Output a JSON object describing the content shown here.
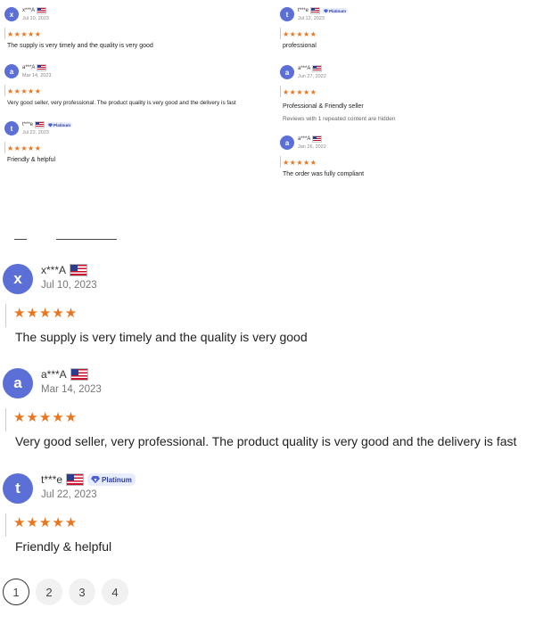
{
  "colors": {
    "avatar": "#5b6fd6",
    "star": "#e8761e",
    "badge_bg": "#e8ecff",
    "badge_text": "#2b3d9e"
  },
  "thumbnail_reviews": [
    {
      "initial": "x",
      "name": "x***A",
      "date": "Jul 10, 2023",
      "stars": "★★★★★",
      "text": "The supply is very timely and the quality is very good",
      "badge": ""
    },
    {
      "initial": "a",
      "name": "a***A",
      "date": "Mar 14, 2023",
      "stars": "★★★★★",
      "text": "Very good seller, very professional. The product quality is very good and the delivery is fast",
      "badge": ""
    },
    {
      "initial": "t",
      "name": "t***e",
      "date": "Jul 22, 2023",
      "stars": "★★★★★",
      "text": "Friendly & helpful",
      "badge": "Platinum"
    },
    {
      "initial": "t",
      "name": "t***e",
      "date": "Jul 12, 2023",
      "stars": "★★★★★",
      "text": "professional",
      "badge": "Platinum"
    },
    {
      "initial": "a",
      "name": "a***A",
      "date": "Jun 27, 2022",
      "stars": "★★★★★",
      "text": "Professional & Friendly seller",
      "note": "Reviews with 1 repeated content are hidden",
      "badge": ""
    },
    {
      "initial": "a",
      "name": "a***A",
      "date": "Jan 26, 2022",
      "stars": "★★★★★",
      "text": "The order was fully compliant",
      "badge": ""
    }
  ],
  "reviews": [
    {
      "initial": "x",
      "name": "x***A",
      "date": "Jul 10, 2023",
      "stars": "★★★★★",
      "text": "The supply is very timely and the quality is very good",
      "badge": ""
    },
    {
      "initial": "a",
      "name": "a***A",
      "date": "Mar 14, 2023",
      "stars": "★★★★★",
      "text": "Very good seller, very professional. The product quality is very good and the delivery is fast",
      "badge": ""
    },
    {
      "initial": "t",
      "name": "t***e",
      "date": "Jul 22, 2023",
      "stars": "★★★★★",
      "text": "Friendly & helpful",
      "badge": "Platinum"
    }
  ],
  "pagination": {
    "pages": [
      "1",
      "2",
      "3",
      "4"
    ],
    "current": "1"
  }
}
